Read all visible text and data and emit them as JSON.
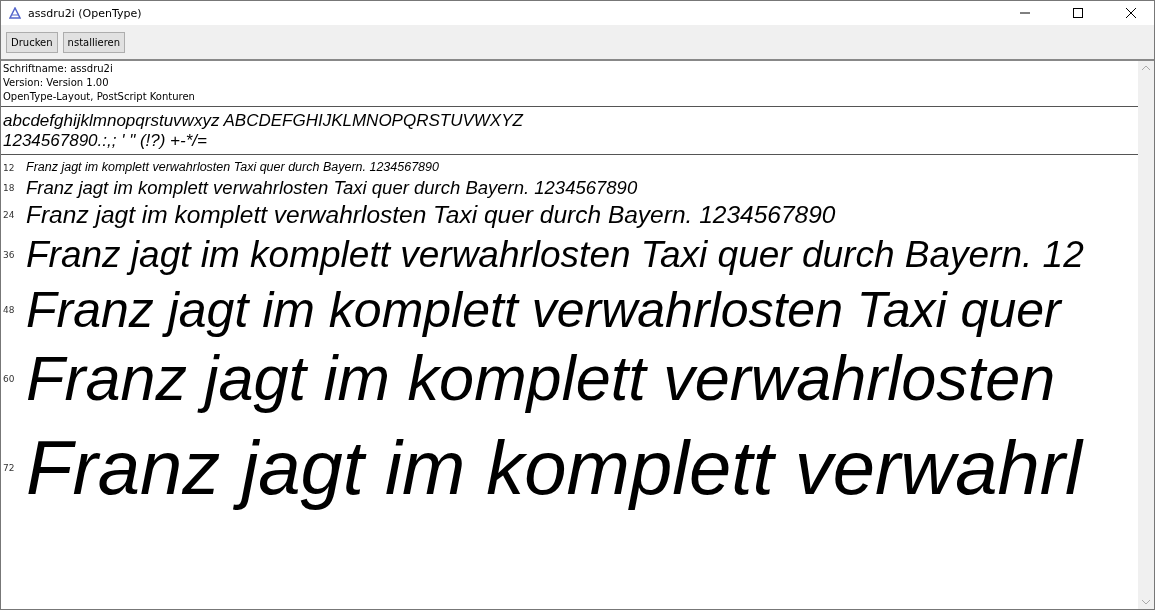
{
  "window": {
    "title": "assdru2i (OpenType)"
  },
  "toolbar": {
    "buttons": [
      "Drucken",
      "nstallieren"
    ]
  },
  "info": [
    "Schriftname: assdru2i",
    "Version: Version 1.00",
    "OpenType-Layout, PostScript Konturen"
  ],
  "charset": [
    "abcdefghijklmnopqrstuvwxyz ABCDEFGHIJKLMNOPQRSTUVWXYZ",
    "1234567890.:,; ' \" (!?) +-*/="
  ],
  "samples": [
    {
      "size": "12",
      "text": "Franz jagt im komplett verwahrlosten Taxi quer durch Bayern. 1234567890"
    },
    {
      "size": "18",
      "text": "Franz jagt im komplett verwahrlosten Taxi quer durch Bayern. 1234567890"
    },
    {
      "size": "24",
      "text": "Franz jagt im komplett verwahrlosten Taxi quer durch Bayern. 1234567890"
    },
    {
      "size": "36",
      "text": "Franz jagt im komplett verwahrlosten Taxi quer durch Bayern. 12"
    },
    {
      "size": "48",
      "text": "Franz jagt im komplett verwahrlosten Taxi quer"
    },
    {
      "size": "60",
      "text": "Franz jagt im komplett verwahrlosten"
    },
    {
      "size": "72",
      "text": "Franz jagt im komplett verwahrl"
    }
  ]
}
